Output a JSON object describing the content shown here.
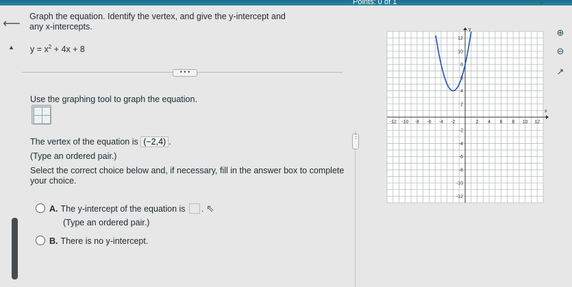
{
  "header": {
    "points": "Points: 0 of 1"
  },
  "nav": {
    "back_icon": "left-arrow-icon",
    "collapse_icon": "triangle-up-icon"
  },
  "question": {
    "prompt": "Graph the equation. Identify the vertex, and give the y-intercept and any x-intercepts.",
    "equation_lhs": "y = x",
    "equation_exp": "2",
    "equation_rhs": " + 4x + 8",
    "more_label": "• • •"
  },
  "work": {
    "instruction": "Use the graphing tool to graph the equation.",
    "vertex_prefix": "The vertex of the equation is",
    "vertex_answer": "(−2,4)",
    "vertex_suffix": ".",
    "vertex_hint": "(Type an ordered pair.)",
    "select_prompt": "Select the correct choice below and, if necessary, fill in the answer box to complete your choice.",
    "choices": [
      {
        "letter": "A.",
        "text": "The y-intercept of the equation is",
        "suffix": ".",
        "hint": "(Type an ordered pair.)"
      },
      {
        "letter": "B.",
        "text": "There is no y-intercept."
      }
    ]
  },
  "graph": {
    "x_axis_label": "x",
    "y_axis_label": "y",
    "x_ticks": [
      "-12",
      "-10",
      "-8",
      "-6",
      "-4",
      "-2",
      "2",
      "4",
      "6",
      "8",
      "10",
      "12"
    ],
    "y_ticks": [
      "12",
      "10",
      "8",
      "6",
      "4",
      "2",
      "-2",
      "-4",
      "-6",
      "-8",
      "-10",
      "-12"
    ],
    "curve_color": "#1f4fb5",
    "grid_color": "#b9bdbf",
    "axis_color": "#333333"
  },
  "tools": [
    "zoom-in-icon",
    "zoom-out-icon",
    "external-link-icon"
  ]
}
